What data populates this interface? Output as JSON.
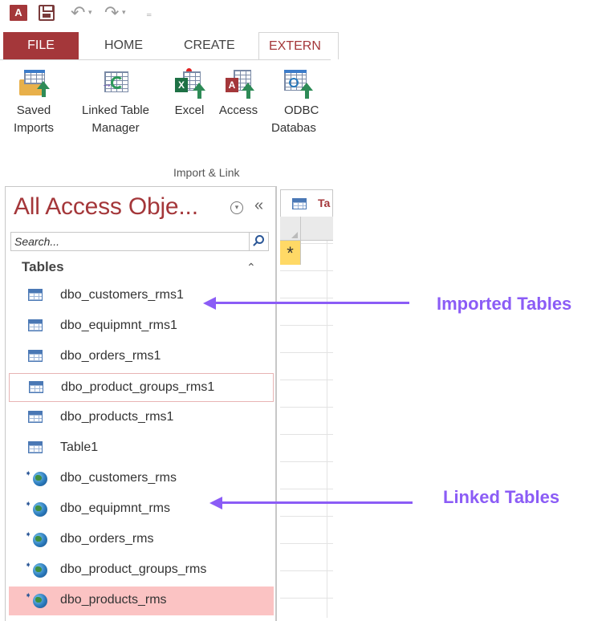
{
  "quick_access": {
    "app_logo_text": "A",
    "undo_icon": "undo-icon",
    "redo_icon": "redo-icon"
  },
  "ribbon": {
    "tabs": [
      {
        "label": "FILE"
      },
      {
        "label": "HOME"
      },
      {
        "label": "CREATE"
      },
      {
        "label": "EXTERN"
      }
    ],
    "buttons": [
      {
        "label_line1": "Saved",
        "label_line2": "Imports"
      },
      {
        "label_line1": "Linked Table",
        "label_line2": "Manager"
      },
      {
        "label_line1": "Excel",
        "label_line2": ""
      },
      {
        "label_line1": "Access",
        "label_line2": ""
      },
      {
        "label_line1": "ODBC",
        "label_line2": "Databas"
      }
    ],
    "group_label": "Import & Link"
  },
  "nav_pane": {
    "title": "All Access Obje...",
    "collapse_glyph": "«",
    "search_placeholder": "Search...",
    "section": "Tables",
    "section_glyph": "⌃",
    "items": [
      {
        "label": "dbo_customers_rms1",
        "kind": "table"
      },
      {
        "label": "dbo_equipmnt_rms1",
        "kind": "table"
      },
      {
        "label": "dbo_orders_rms1",
        "kind": "table"
      },
      {
        "label": "dbo_product_groups_rms1",
        "kind": "table"
      },
      {
        "label": "dbo_products_rms1",
        "kind": "table"
      },
      {
        "label": "Table1",
        "kind": "table"
      },
      {
        "label": "dbo_customers_rms",
        "kind": "linked"
      },
      {
        "label": "dbo_equipmnt_rms",
        "kind": "linked"
      },
      {
        "label": "dbo_orders_rms",
        "kind": "linked"
      },
      {
        "label": "dbo_product_groups_rms",
        "kind": "linked"
      },
      {
        "label": "dbo_products_rms",
        "kind": "linked"
      }
    ]
  },
  "document": {
    "tab_label": "Ta",
    "new_record_glyph": "*"
  },
  "annotations": {
    "imported": "Imported Tables",
    "linked": "Linked Tables",
    "color": "#8b5cf6"
  },
  "colors": {
    "accent": "#a4373a",
    "selected_row": "#fbc3c3",
    "new_row": "#ffd966"
  }
}
